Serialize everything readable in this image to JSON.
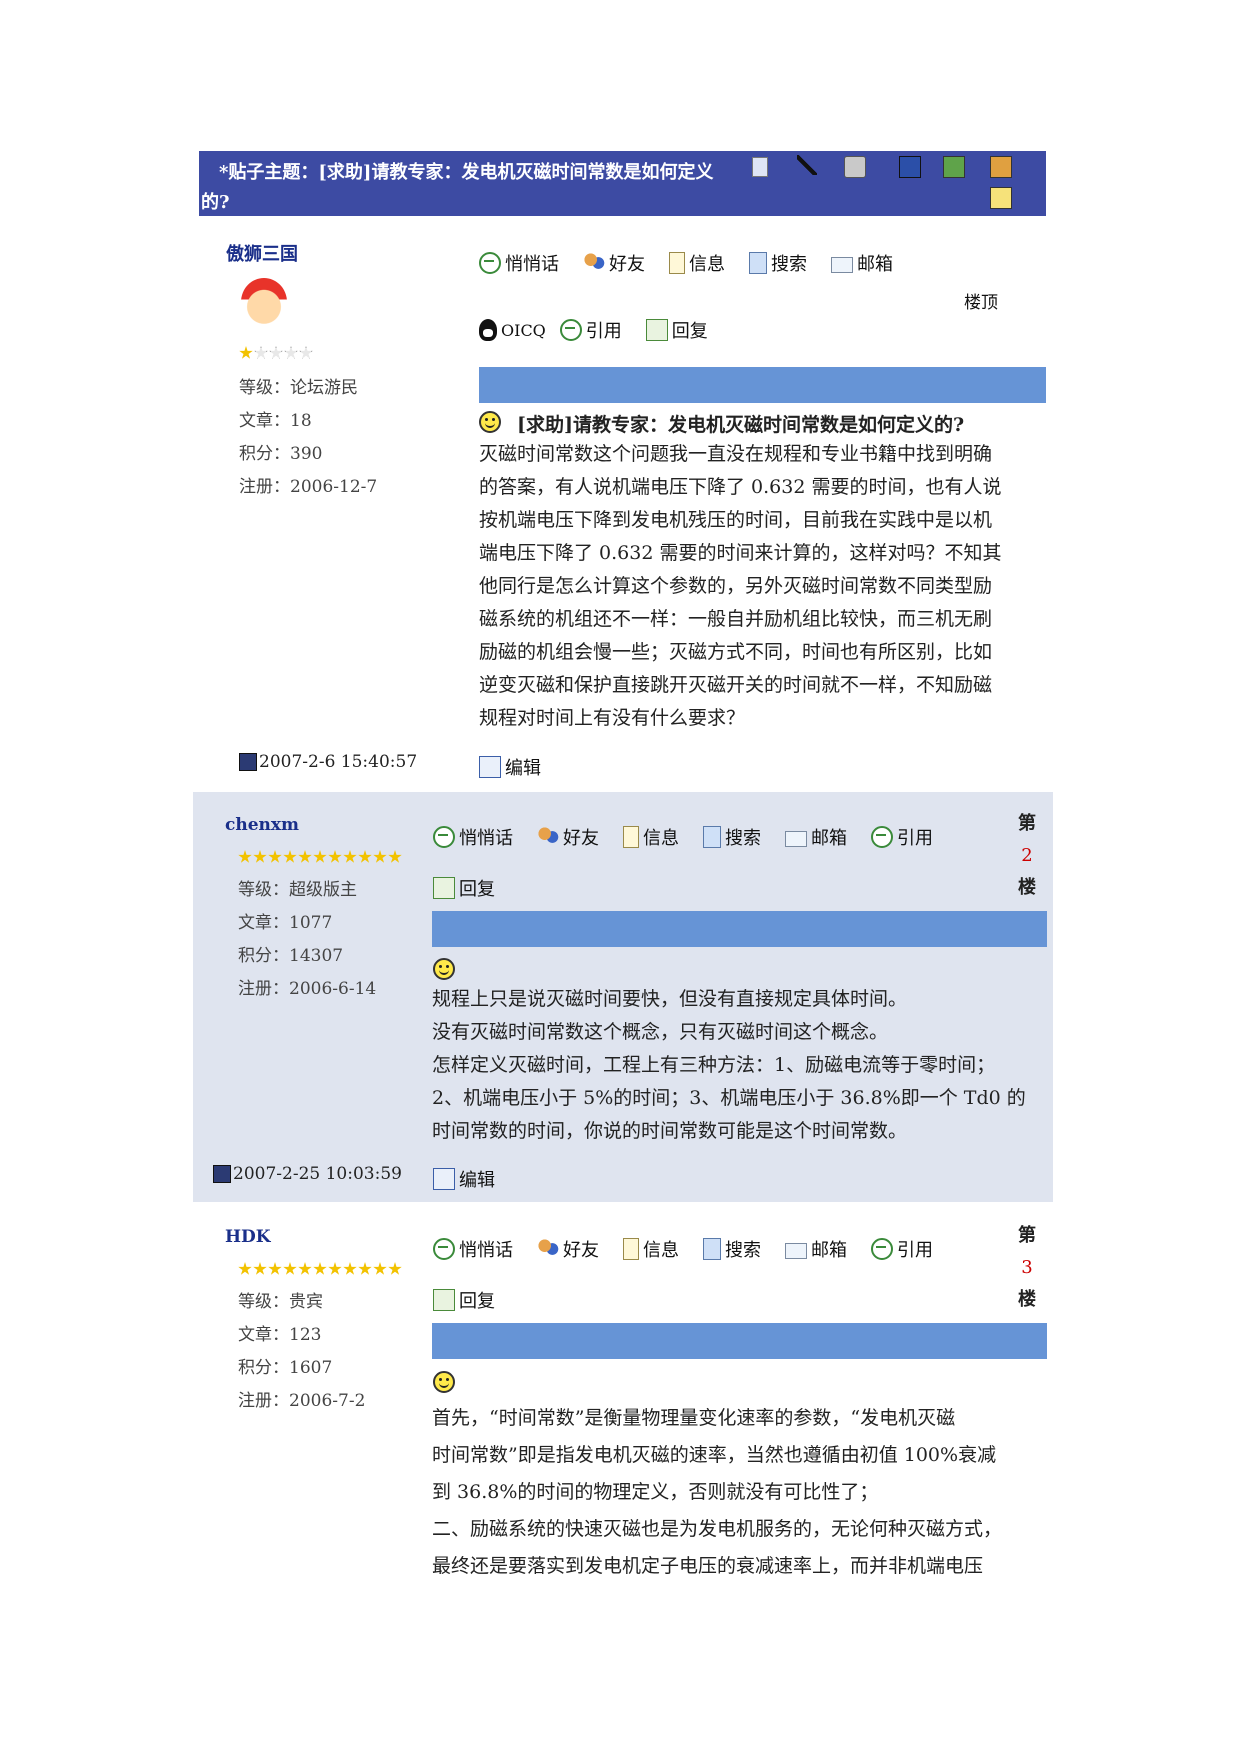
{
  "topic": {
    "line1": "*贴子主题：[求助]请教专家：发电机灭磁时间常数是如何定义",
    "line2": "的?"
  },
  "labels": {
    "whisper": "悄悄话",
    "friend": "好友",
    "info": "信息",
    "search": "搜索",
    "mail": "邮箱",
    "quote": "引用",
    "reply": "回复",
    "oicq": "OICQ",
    "edit": "编辑",
    "top": "楼顶"
  },
  "posts": [
    {
      "user": "傲狮三国",
      "stars_filled": 1,
      "stars_total": 5,
      "level": "等级：论坛游民",
      "articles": "文章：18",
      "points": "积分：390",
      "register": "注册：2006-12-7",
      "title": "[求助]请教专家：发电机灭磁时间常数是如何定义的?",
      "body": [
        "灭磁时间常数这个问题我一直没在规程和专业书籍中找到明确",
        "的答案，有人说机端电压下降了 0.632 需要的时间，也有人说",
        "按机端电压下降到发电机残压的时间，目前我在实践中是以机",
        "端电压下降了 0.632 需要的时间来计算的，这样对吗？不知其",
        "他同行是怎么计算这个参数的，另外灭磁时间常数不同类型励",
        "磁系统的机组还不一样：一般自并励机组比较快，而三机无刷",
        "励磁的机组会慢一些；灭磁方式不同，时间也有所区别，比如",
        "逆变灭磁和保护直接跳开灭磁开关的时间就不一样，不知励磁",
        "规程对时间上有没有什么要求？"
      ],
      "timestamp": "2007-2-6 15:40:57"
    },
    {
      "user": "chenxm",
      "stars_filled": 11,
      "stars_total": 11,
      "level": "等级：超级版主",
      "articles": "文章：1077",
      "points": "积分：14307",
      "register": "注册：2006-6-14",
      "floor_pre": "第",
      "floor_num": "2",
      "floor_post": "楼",
      "body": [
        "规程上只是说灭磁时间要快，但没有直接规定具体时间。",
        "没有灭磁时间常数这个概念，只有灭磁时间这个概念。",
        "怎样定义灭磁时间，工程上有三种方法：1、励磁电流等于零时间；",
        "2、机端电压小于 5%的时间；3、机端电压小于 36.8%即一个 Td0 的",
        "时间常数的时间，你说的时间常数可能是这个时间常数。"
      ],
      "timestamp": "2007-2-25 10:03:59"
    },
    {
      "user": "HDK",
      "stars_filled": 11,
      "stars_total": 11,
      "level": "等级：贵宾",
      "articles": "文章：123",
      "points": "积分：1607",
      "register": "注册：2006-7-2",
      "floor_pre": "第",
      "floor_num": "3",
      "floor_post": "楼",
      "body": [
        "首先，“时间常数”是衡量物理量变化速率的参数，“发电机灭磁",
        "时间常数”即是指发电机灭磁的速率，当然也遵循由初值 100%衰减",
        "到 36.8%的时间的物理定义，否则就没有可比性了；",
        "二、励磁系统的快速灭磁也是为发电机服务的，无论何种灭磁方式，",
        "最终还是要落实到发电机定子电压的衰减速率上，而并非机端电压"
      ]
    }
  ]
}
